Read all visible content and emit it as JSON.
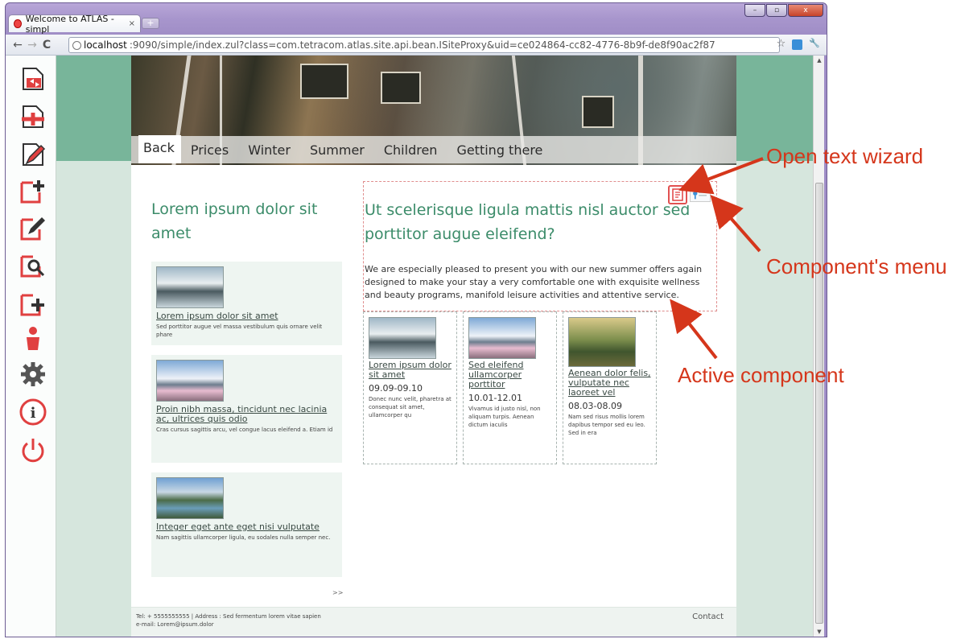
{
  "browser": {
    "tab_title": "Welcome to ATLAS - simpl",
    "tab_close": "×",
    "new_tab": "+",
    "url_host": "localhost",
    "url_path": ":9090/simple/index.zul?class=com.tetracom.atlas.site.api.bean.ISiteProxy&uid=ce024864-cc82-4776-8b9f-de8f90ac2f87",
    "back_icon": "←",
    "forward_icon": "→",
    "reload_icon": "C",
    "star_icon": "☆",
    "wrench_icon": "🔧",
    "min_label": "–",
    "max_label": "▫",
    "close_label": "x"
  },
  "nav": {
    "items": [
      "Back",
      "Prices",
      "Winter",
      "Summer",
      "Children",
      "Getting there"
    ]
  },
  "left": {
    "heading": "Lorem ipsum dolor sit amet",
    "teasers": [
      {
        "title": "Lorem ipsum dolor sit amet",
        "text": "Sed porttitor augue vel massa vestibulum quis ornare velit phare"
      },
      {
        "title": "Proin nibh massa, tincidunt nec lacinia ac, ultrices quis odio",
        "text": "Cras cursus sagittis arcu, vel congue lacus eleifend a. Etiam id"
      },
      {
        "title": "Integer eget ante eget nisi vulputate",
        "text": "Nam sagittis ullamcorper ligula, eu sodales nulla semper nec."
      }
    ],
    "more": ">>"
  },
  "main": {
    "heading": "Ut scelerisque ligula mattis nisl auctor sed porttitor augue eleifend?",
    "paragraph": "We are especially pleased to present you with our new summer offers again designed to make your stay a very comfortable one with exquisite wellness and beauty programs, manifold leisure activities and attentive service.",
    "cards": [
      {
        "title": "Lorem ipsum dolor sit amet",
        "date": "09.09-09.10",
        "text": "Donec nunc velit, pharetra at consequat sit amet, ullamcorper qu"
      },
      {
        "title": "Sed eleifend ullamcorper porttitor",
        "date": "10.01-12.01",
        "text": "Vivamus id justo nisl, non aliquam turpis. Aenean dictum iaculis"
      },
      {
        "title": "Aenean dolor felis, vulputate nec laoreet vel",
        "date": "08.03-08.09",
        "text": "Nam sed risus mollis lorem dapibus tempor sed eu leo. Sed in era"
      }
    ]
  },
  "footer": {
    "line1": "Tel: + 5555555555 | Address : Sed fermentum lorem vitae sapien",
    "line2": "e-mail: Lorem@ipsum.dolor",
    "contact": "Contact"
  },
  "annotations": {
    "open_text_wizard": "Open text wizard",
    "components_menu": "Component's menu",
    "active_component": "Active component"
  },
  "colors": {
    "accent_green": "#3c8c6a",
    "band_green": "#78b59a",
    "annotation_red": "#d5361b"
  },
  "atlas_tools": [
    "switch-page-icon",
    "add-page-icon",
    "edit-page-icon",
    "add-component-icon",
    "edit-component-icon",
    "search-page-icon",
    "new-page-icon",
    "user-icon",
    "settings-gear-icon",
    "info-icon",
    "power-icon"
  ]
}
